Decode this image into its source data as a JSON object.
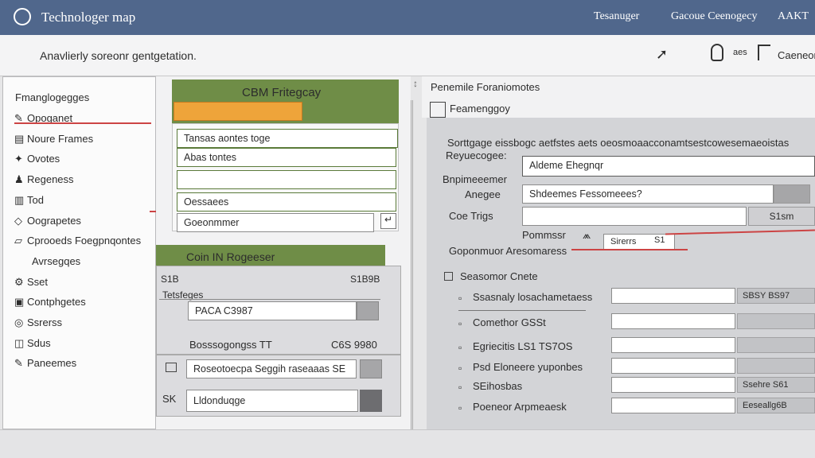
{
  "header": {
    "app_title": "Technologer map",
    "nav": [
      "Tesanuger",
      "Gacoue Ceenogecy",
      "AAKT"
    ]
  },
  "subheader": {
    "caption": "Anavlierly soreonr gentgetation.",
    "right_label": "Caeneon",
    "side_label": "aes"
  },
  "sidebar": {
    "title": "Fmanglogegges",
    "items": [
      {
        "label": "Opoganet",
        "icon": "pen-icon"
      },
      {
        "label": "Noure Frames",
        "icon": "document-icon"
      },
      {
        "label": "Ovotes",
        "icon": "star-icon"
      },
      {
        "label": "Regeness",
        "icon": "people-icon"
      },
      {
        "label": "Tod",
        "icon": "chart-icon"
      },
      {
        "label": "Oograpetes",
        "icon": "diamond-icon"
      },
      {
        "label": "Cprooeds Foegpnqontes",
        "icon": "folder-icon"
      },
      {
        "label": "Avrsegqes",
        "icon": "none"
      },
      {
        "label": "Sset",
        "icon": "gear-icon"
      },
      {
        "label": "Contphgetes",
        "icon": "book-icon"
      },
      {
        "label": "Ssrerss",
        "icon": "globe-icon"
      },
      {
        "label": "Sdus",
        "icon": "cylinder-icon"
      },
      {
        "label": "Paneemes",
        "icon": "pen-icon"
      }
    ]
  },
  "middle": {
    "card1_title": "CBM Fritegcay",
    "card1_rows": [
      "Tansas aontes toge",
      "Abas tontes",
      "Oessaees",
      "Goeonmmer"
    ],
    "card2_title": "Coin IN Rogeeser",
    "card2_left_code": "S1B",
    "card2_right_code": "S1B9B",
    "card2_field_label": "Tetsfeges",
    "card2_input": "PACA C3987",
    "summary_label": "Bosssogongss TT",
    "summary_value": "C6S 9980",
    "bottom_input1": "Roseotoecpa Seggih raseaaas SE",
    "bottom_input2": "Lldonduqge"
  },
  "right": {
    "section_title": "Penemile Foraniomotes",
    "subsection_title": "Feamenggoy",
    "description": "Sorttgage eissbogc aetfstes aets oeosmoaacconamtsestcowesemaeoistas",
    "desc_second": "Reyuecogee:",
    "fields": [
      {
        "label": "Bnpimeeemer",
        "value": "Aldeme Ehegnqr"
      },
      {
        "label": "Anegee",
        "value": "Shdeemes Fessomeees?"
      },
      {
        "label": "Coe Trigs",
        "value": ""
      }
    ],
    "small_btn": "S1sm",
    "pointer_label": "Pommssr",
    "pointer_value": "Sirerrs",
    "pointer_code": "S1",
    "group_label": "Goponmuor Aresomaress",
    "list_title": "Seasomor Cnete",
    "list_items": [
      {
        "label": "Ssasnaly losachametaess",
        "value": "SBSY BS97"
      },
      {
        "label": "Comethor GSSt",
        "value": ""
      },
      {
        "label": "Egriecitis LS1 TS7OS",
        "value": ""
      },
      {
        "label": "Psd Eloneere yuponbes",
        "value": ""
      },
      {
        "label": "SEihosbas",
        "value": "Ssehre S61"
      },
      {
        "label": "Poeneor Arpmeaesk",
        "value": "Eeseallg6B"
      }
    ]
  },
  "colors": {
    "header": "#50678c",
    "accent_green": "#6f8d47",
    "accent_orange": "#eea43a",
    "line_red": "#c44444"
  }
}
